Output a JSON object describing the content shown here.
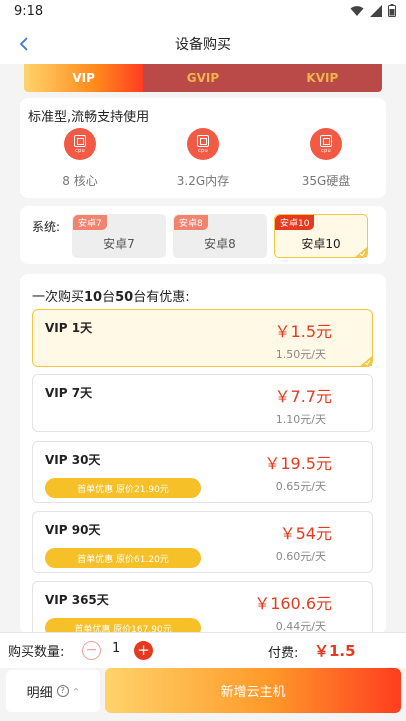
{
  "status_bar": {
    "time": "9:18",
    "icons": [
      "wifi-icon",
      "signal-icon",
      "battery-icon"
    ]
  },
  "nav": {
    "title": "设备购买",
    "back_icon": "chevron-left-icon"
  },
  "tabs": [
    {
      "label": "VIP",
      "active": true
    },
    {
      "label": "GVIP",
      "active": false
    },
    {
      "label": "KVIP",
      "active": false
    }
  ],
  "spec": {
    "title": "标准型,流畅支持使用",
    "icon_label": "cpu",
    "items": [
      {
        "value": "8 核心",
        "icon": "cpu-icon"
      },
      {
        "value": "3.2G内存",
        "icon": "cpu-icon"
      },
      {
        "value": "35G硬盘",
        "icon": "cpu-icon"
      }
    ]
  },
  "os": {
    "label": "系统:",
    "options": [
      {
        "tag": "安卓7",
        "name": "安卓7",
        "selected": false
      },
      {
        "tag": "安卓8",
        "name": "安卓8",
        "selected": false
      },
      {
        "tag": "安卓10",
        "name": "安卓10",
        "selected": true
      }
    ]
  },
  "plans": {
    "promo_prefix": "一次购买",
    "promo_n1": "10",
    "promo_mid": "台",
    "promo_n2": "50",
    "promo_suffix": "台有优惠:",
    "items": [
      {
        "name": "VIP 1天",
        "price": "￥1.5元",
        "daily": "1.50元/天",
        "badge": "",
        "selected": true
      },
      {
        "name": "VIP 7天",
        "price": "￥7.7元",
        "daily": "1.10元/天",
        "badge": "",
        "selected": false
      },
      {
        "name": "VIP 30天",
        "price": "￥19.5元",
        "daily": "0.65元/天",
        "badge": "首单优惠 原价21.90元",
        "selected": false
      },
      {
        "name": "VIP 90天",
        "price": "￥54元",
        "daily": "0.60元/天",
        "badge": "首单优惠 原价61.20元",
        "selected": false
      },
      {
        "name": "VIP 365天",
        "price": "￥160.6元",
        "daily": "0.44元/天",
        "badge": "首单优惠 原价167.90元",
        "selected": false
      }
    ]
  },
  "quantity": {
    "label": "购买数量:",
    "minus": "−",
    "value": "1",
    "plus": "+",
    "total_label": "付费:",
    "total_value": "￥1.5"
  },
  "bottom": {
    "detail_label": "明细",
    "help_glyph": "?",
    "chevron": "^",
    "buy_label": "新增云主机"
  },
  "colors": {
    "accent_red": "#e6391f",
    "gold": "#f6c028",
    "tab_inactive": "#b94a48"
  }
}
